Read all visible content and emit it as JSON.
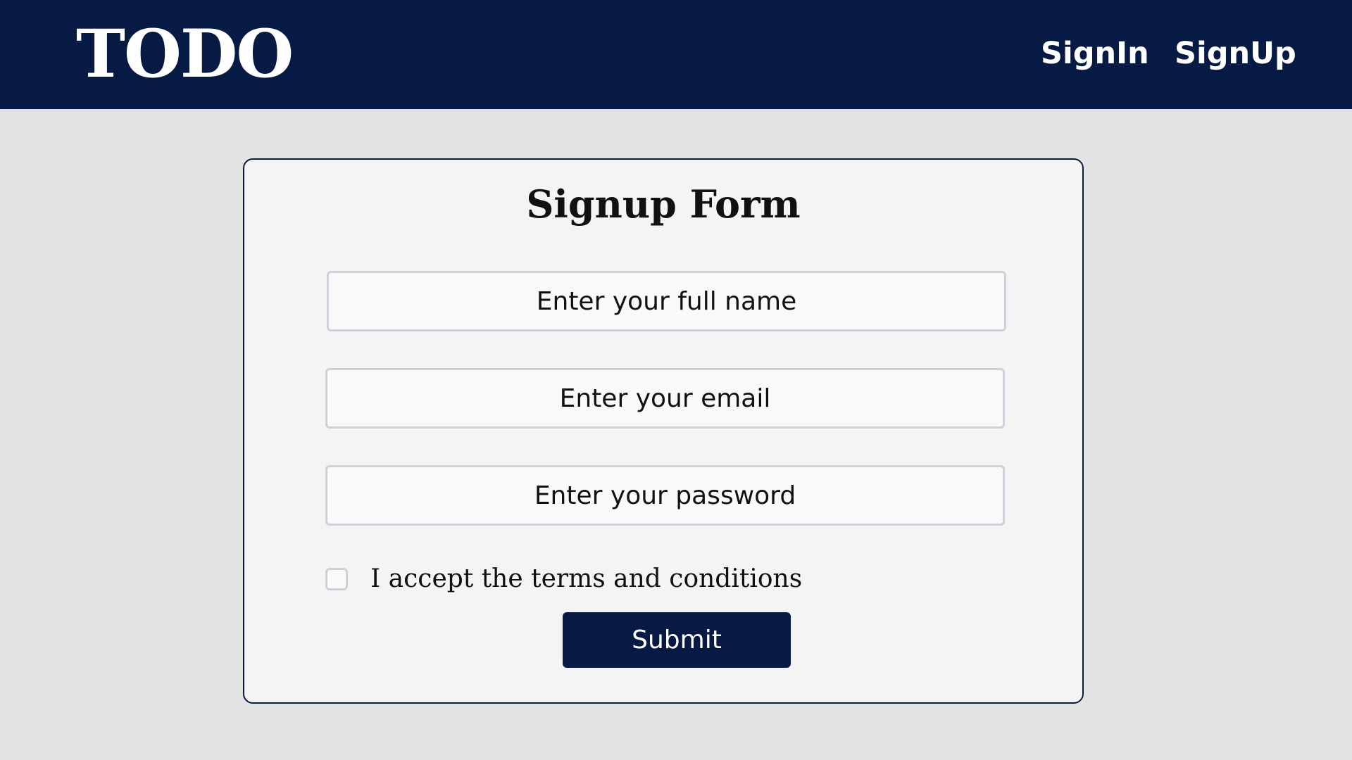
{
  "header": {
    "logo": "TODO",
    "nav": {
      "signin_label": "SignIn",
      "signup_label": "SignUp"
    }
  },
  "form": {
    "title": "Signup Form",
    "fields": {
      "full_name": {
        "placeholder": "Enter your full name",
        "value": ""
      },
      "email": {
        "placeholder": "Enter your email",
        "value": ""
      },
      "password": {
        "placeholder": "Enter your password",
        "value": ""
      }
    },
    "terms": {
      "label": "I accept the terms and conditions",
      "checked": false
    },
    "submit_label": "Submit"
  },
  "colors": {
    "header_bg": "#071a43",
    "page_bg": "#e3e3e4",
    "card_bg": "#f4f4f5",
    "button_bg": "#071a43",
    "field_border": "#cfd0da"
  }
}
